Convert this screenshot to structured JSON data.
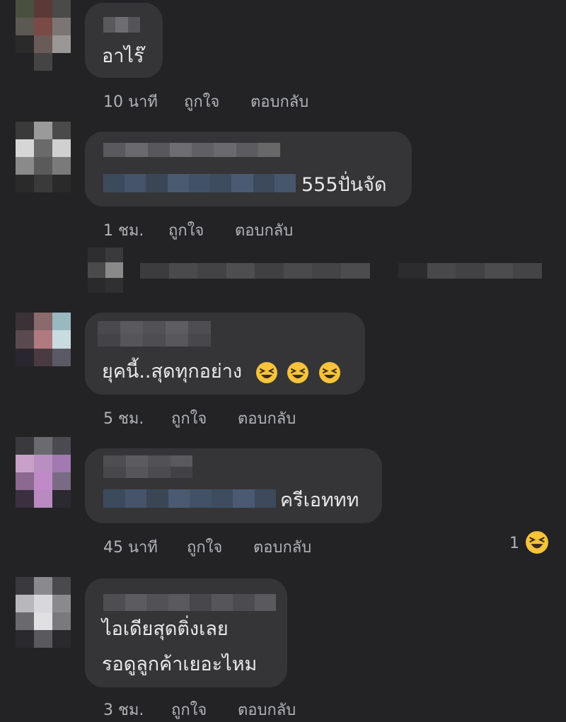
{
  "comments": [
    {
      "text": "อาไร๊",
      "time": "10 นาที",
      "like": "ถูกใจ",
      "reply": "ตอบกลับ"
    },
    {
      "text": "555ปั่นจัด",
      "time": "1 ชม.",
      "like": "ถูกใจ",
      "reply": "ตอบกลับ"
    },
    {
      "text": "ยุคนี้..สุดทุกอย่าง",
      "time": "5 ชม.",
      "like": "ถูกใจ",
      "reply": "ตอบกลับ",
      "emoji": [
        "laughing-emoji",
        "laughing-emoji",
        "laughing-emoji"
      ]
    },
    {
      "text": "ครีเอททท",
      "time": "45 นาที",
      "like": "ถูกใจ",
      "reply": "ตอบกลับ",
      "reaction_count": "1",
      "reaction_icon": "laughing-reaction-icon"
    },
    {
      "text_line1": "ไอเดียสุดติ่งเลย",
      "text_line2": "รอดูลูกค้าเยอะไหม",
      "time": "3 ชม.",
      "like": "ถูกใจ",
      "reply": "ตอบกลับ"
    }
  ],
  "colors": {
    "background": "#232325",
    "bubble": "#353538",
    "text": "#e8e8ea",
    "meta": "#b0b3b8",
    "emoji_face": "#f7c33b"
  }
}
